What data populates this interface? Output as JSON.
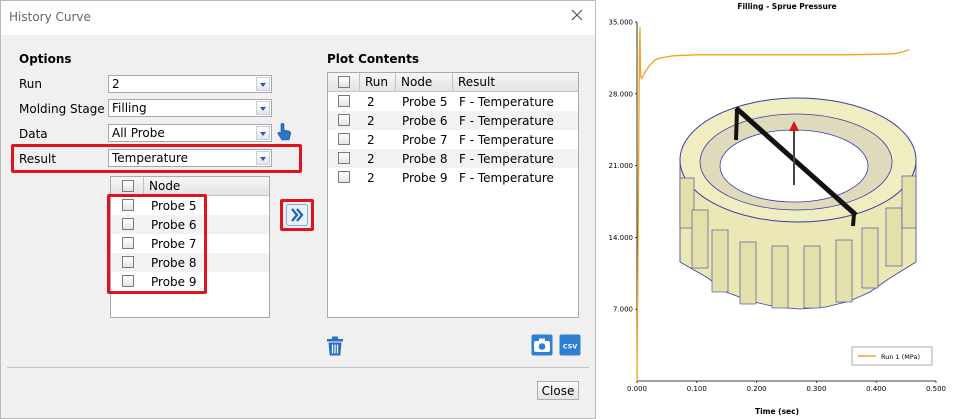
{
  "dialog": {
    "title": "History Curve",
    "options_title": "Options",
    "plot_title": "Plot Contents",
    "fields": [
      {
        "label": "Run",
        "value": "2"
      },
      {
        "label": "Molding Stage",
        "value": "Filling"
      },
      {
        "label": "Data",
        "value": "All Probe"
      },
      {
        "label": "Result",
        "value": "Temperature"
      }
    ],
    "node_header": "Node",
    "nodes": [
      "Probe 5",
      "Probe 6",
      "Probe 7",
      "Probe 8",
      "Probe 9"
    ],
    "plot_headers": {
      "run": "Run",
      "node": "Node",
      "result": "Result"
    },
    "plot_rows": [
      {
        "run": "2",
        "node": "Probe 5",
        "result": "F - Temperature"
      },
      {
        "run": "2",
        "node": "Probe 6",
        "result": "F - Temperature"
      },
      {
        "run": "2",
        "node": "Probe 7",
        "result": "F - Temperature"
      },
      {
        "run": "2",
        "node": "Probe 8",
        "result": "F - Temperature"
      },
      {
        "run": "2",
        "node": "Probe 9",
        "result": "F - Temperature"
      }
    ],
    "csv_label": "CSV",
    "close_label": "Close",
    "accent": "#e0141e"
  },
  "chart_data": {
    "type": "line",
    "title": "Filling - Sprue Pressure",
    "xlabel": "Time (sec)",
    "ylabel": "",
    "xlim": [
      0,
      0.5
    ],
    "ylim": [
      0,
      35
    ],
    "x_ticks": [
      "0.000",
      "0.100",
      "0.200",
      "0.300",
      "0.400",
      "0.500"
    ],
    "y_ticks": [
      "7.000",
      "14.000",
      "21.000",
      "28.000",
      "35.000"
    ],
    "series": [
      {
        "name": "Run 1 (MPa)",
        "color": "#f5a31a",
        "x": [
          0.0,
          0.002,
          0.004,
          0.005,
          0.006,
          0.008,
          0.012,
          0.02,
          0.03,
          0.04,
          0.05,
          0.06,
          0.08,
          0.1,
          0.15,
          0.2,
          0.25,
          0.3,
          0.35,
          0.4,
          0.43,
          0.445,
          0.455
        ],
        "values": [
          0.0,
          15.0,
          32.0,
          34.5,
          29.7,
          29.5,
          30.0,
          30.7,
          31.3,
          31.5,
          31.6,
          31.7,
          31.75,
          31.8,
          31.8,
          31.8,
          31.8,
          31.8,
          31.8,
          31.85,
          31.9,
          32.1,
          32.3
        ]
      }
    ],
    "legend": "bottom-right",
    "grid": false
  }
}
